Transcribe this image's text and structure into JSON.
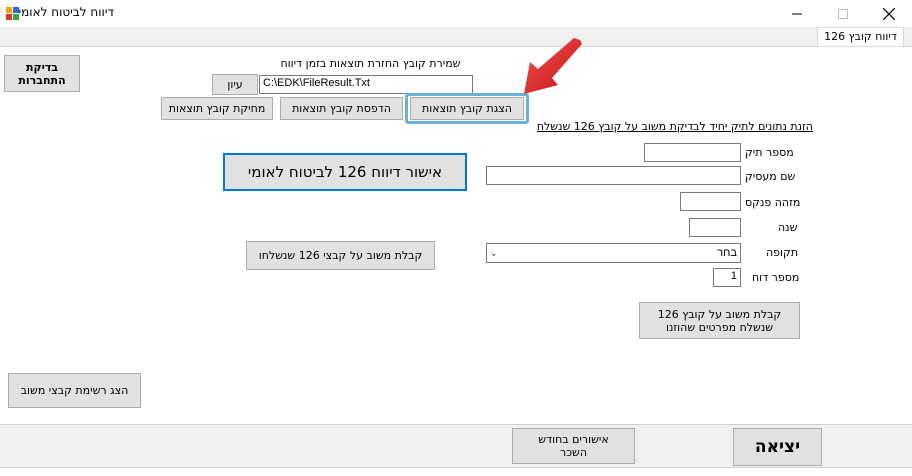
{
  "window": {
    "title": "דיווח לביטוח לאומי",
    "tab_label": "דיווח קובץ 126"
  },
  "buttons": {
    "check_connection": "בדיקת\nהתחברות",
    "browse": "עיון",
    "show_file": "הצגת קובץ תוצאות",
    "print_file": "הדפסת קובץ תוצאות",
    "delete_file": "מחיקת קובץ תוצאות",
    "approve_report": "אישור דיווח 126 לביטוח לאומי",
    "receive_sent": "קבלת משוב על קבצי 126 שנשלחו",
    "receive_details": "קבלת משוב על קובץ 126\nשנשלח מפרטים שהוזנו",
    "show_feedback_list": "הצג רשימת קבצי משוב",
    "monthly_approvals": "אישורים בחודש\nהשכר",
    "exit": "יציאה"
  },
  "file_section": {
    "label": "שמירת קובץ החזרת תוצאות בזמן דיווח",
    "path_value": "C:\\EDK\\FileResult.Txt"
  },
  "form": {
    "heading": "הזנת נתונים לתיק יחיד לבדיקת משוב על קובץ 126 שנשלח",
    "file_number_label": "מספר תיק",
    "employer_name_label": "שם מעסיק",
    "ledger_id_label": "מזהה פנקס",
    "year_label": "שנה",
    "period_label": "תקופה",
    "period_value": "בחר",
    "report_number_label": "מספר דוח",
    "report_number_value": "1"
  },
  "colors": {
    "highlight_border": "#6bb3d6",
    "arrow_red": "#e02020",
    "primary_border": "#0078d7"
  }
}
